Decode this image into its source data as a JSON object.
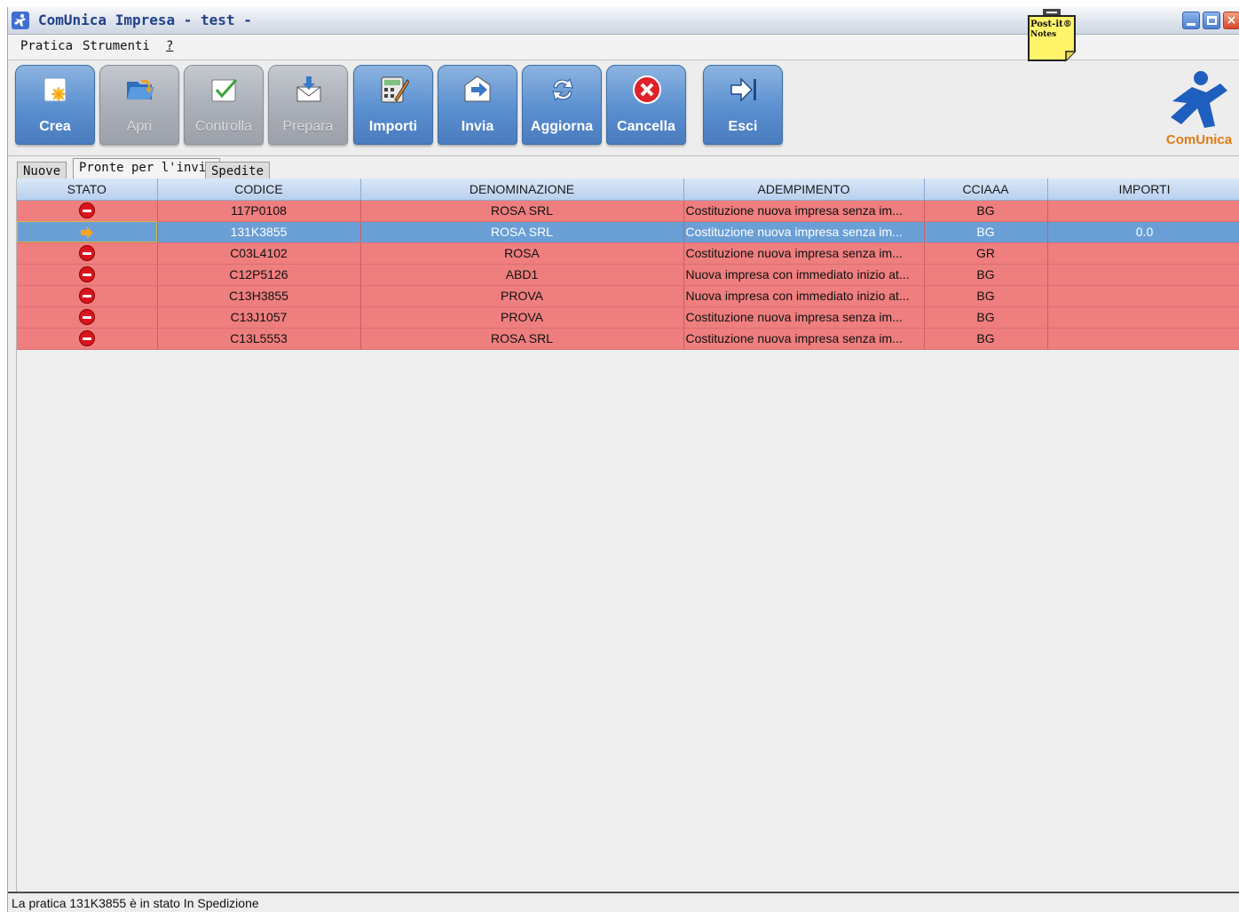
{
  "window": {
    "title": "ComUnica Impresa - test -"
  },
  "postit": {
    "line1": "Post-it®",
    "line2": "Notes"
  },
  "menu": {
    "items": [
      {
        "label": "Pratica"
      },
      {
        "label": "Strumenti"
      },
      {
        "label": "?"
      }
    ]
  },
  "toolbar": {
    "buttons": [
      {
        "label": "Crea",
        "enabled": true,
        "icon": "new-document-icon"
      },
      {
        "label": "Apri",
        "enabled": false,
        "icon": "open-folder-icon"
      },
      {
        "label": "Controlla",
        "enabled": false,
        "icon": "check-icon"
      },
      {
        "label": "Prepara",
        "enabled": false,
        "icon": "prepare-envelope-icon"
      },
      {
        "label": "Importi",
        "enabled": true,
        "icon": "calculator-icon"
      },
      {
        "label": "Invia",
        "enabled": true,
        "icon": "send-envelope-icon"
      },
      {
        "label": "Aggiorna",
        "enabled": true,
        "icon": "refresh-icon"
      },
      {
        "label": "Cancella",
        "enabled": true,
        "icon": "cancel-icon"
      },
      {
        "label": "Esci",
        "enabled": true,
        "icon": "exit-icon"
      }
    ]
  },
  "logo": {
    "text": "ComUnica"
  },
  "tabs": [
    {
      "label": "Nuove"
    },
    {
      "label": "Pronte per l'invio",
      "active": true
    },
    {
      "label": "Spedite"
    }
  ],
  "table": {
    "columns": [
      "STATO",
      "CODICE",
      "DENOMINAZIONE",
      "ADEMPIMENTO",
      "CCIAAA",
      "IMPORTI"
    ],
    "rows": [
      {
        "stato": "stop-icon",
        "codice": "117P0108",
        "denominazione": "ROSA SRL",
        "adempimento": "Costituzione nuova impresa senza im...",
        "cciaa": "BG",
        "importi": ""
      },
      {
        "stato": "arrow-icon",
        "codice": "131K3855",
        "denominazione": "ROSA SRL",
        "adempimento": "Costituzione nuova impresa senza im...",
        "cciaa": "BG",
        "importi": "0.0",
        "selected": true
      },
      {
        "stato": "stop-icon",
        "codice": "C03L4102",
        "denominazione": "ROSA",
        "adempimento": "Costituzione nuova impresa senza im...",
        "cciaa": "GR",
        "importi": ""
      },
      {
        "stato": "stop-icon",
        "codice": "C12P5126",
        "denominazione": "ABD1",
        "adempimento": "Nuova impresa con immediato inizio at...",
        "cciaa": "BG",
        "importi": ""
      },
      {
        "stato": "stop-icon",
        "codice": "C13H3855",
        "denominazione": "PROVA",
        "adempimento": "Nuova impresa con immediato inizio at...",
        "cciaa": "BG",
        "importi": ""
      },
      {
        "stato": "stop-icon",
        "codice": "C13J1057",
        "denominazione": "PROVA",
        "adempimento": "Costituzione nuova impresa senza im...",
        "cciaa": "BG",
        "importi": ""
      },
      {
        "stato": "stop-icon",
        "codice": "C13L5553",
        "denominazione": "ROSA SRL",
        "adempimento": "Costituzione nuova impresa senza im...",
        "cciaa": "BG",
        "importi": ""
      }
    ]
  },
  "status": {
    "text": "La pratica 131K3855 è in stato In Spedizione"
  },
  "colors": {
    "error_row": "#ef7e7e",
    "selected_row": "#6a9fd6",
    "button_blue": "#5a8fd0",
    "logo_orange": "#e07a12"
  }
}
